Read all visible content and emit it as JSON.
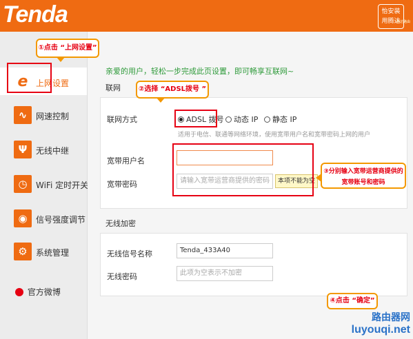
{
  "header": {
    "logo": "Tenda",
    "app_badge": {
      "line1": "怡安装",
      "line2": "用腾达",
      "small": "腾达路由"
    }
  },
  "sidebar": {
    "items": [
      {
        "label": "上网设置",
        "icon": "ie-icon"
      },
      {
        "label": "网速控制",
        "icon": "speed-wave-icon"
      },
      {
        "label": "无线中继",
        "icon": "wireless-icon"
      },
      {
        "label": "WiFi 定时开关",
        "icon": "clock-icon"
      },
      {
        "label": "信号强度调节",
        "icon": "signal-icon"
      },
      {
        "label": "系统管理",
        "icon": "gear-icon"
      }
    ],
    "weibo": "官方微博"
  },
  "main": {
    "welcome": "亲爱的用户，轻松一步完成此页设置，即可畅享互联网~",
    "network": {
      "title": "联网",
      "mode_label": "联网方式",
      "modes": [
        "ADSL 拨号",
        "动态 IP",
        "静态 IP"
      ],
      "selected_mode": "ADSL 拨号",
      "hint": "适用于电信、联通等网络环境，使用宽带用户名和宽带密码上网的用户",
      "username_label": "宽带用户名",
      "username_value": "",
      "password_label": "宽带密码",
      "password_placeholder": "请输入宽带运营商提供的密码",
      "required_tip": "本项不能为空"
    },
    "wireless": {
      "title": "无线加密",
      "ssid_label": "无线信号名称",
      "ssid_value": "Tenda_433A40",
      "wpw_label": "无线密码",
      "wpw_placeholder": "此项为空表示不加密"
    }
  },
  "annotations": {
    "step1": "①点击 “上网设置”",
    "step2": "②选择 “ADSL拨号 ”",
    "step3_line1": "③分别输入宽带运营商提供的",
    "step3_line2": "宽带账号和密码",
    "step4": "④点击 “确定”"
  },
  "watermark": {
    "line1": "路由器网",
    "line2": "luyouqi.net"
  },
  "colors": {
    "brand": "#ef6b12",
    "accent_red": "#e60012",
    "callout_border": "#f39800",
    "welcome_green": "#2e9a3a"
  }
}
